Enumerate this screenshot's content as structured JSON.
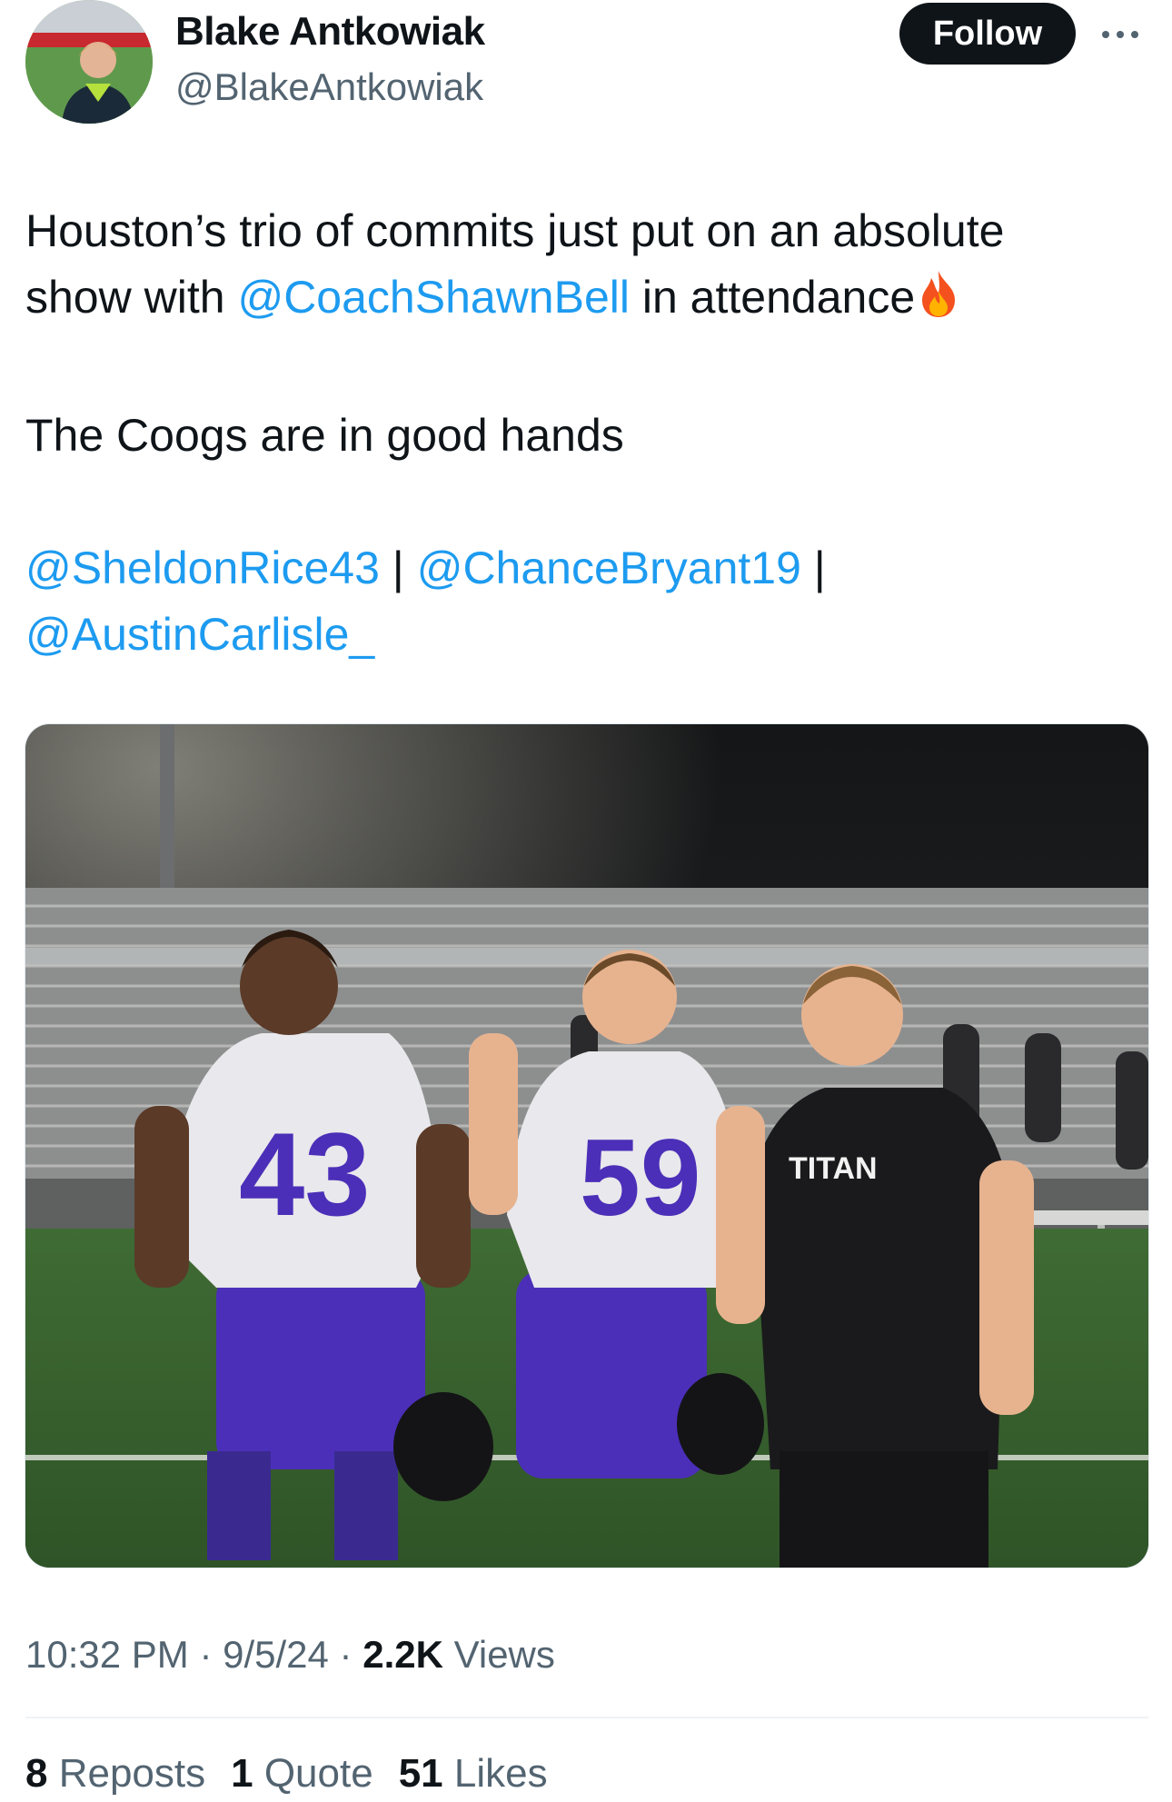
{
  "author": {
    "name": "Blake Antkowiak",
    "handle": "@BlakeAntkowiak"
  },
  "actions": {
    "follow_label": "Follow"
  },
  "tweet": {
    "line1": "Houston’s trio of commits just put on an absolute",
    "line2_prefix": "show with ",
    "mention_coach": "@CoachShawnBell",
    "line2_suffix": " in attendance",
    "line3": "The Coogs are in good hands",
    "mention_1": "@SheldonRice43",
    "separator": " | ",
    "mention_2": "@ChanceBryant19",
    "separator_2": " |",
    "mention_3": "@AustinCarlisle_"
  },
  "photo": {
    "jersey_numbers": [
      "43",
      "59"
    ],
    "shirt_text": "TITAN"
  },
  "meta": {
    "time": "10:32 PM",
    "dot": " · ",
    "date": "9/5/24",
    "views_count": "2.2K",
    "views_label": " Views"
  },
  "stats": {
    "reposts_count": "8",
    "reposts_label": " Reposts",
    "quotes_count": "1",
    "quotes_label": " Quote",
    "likes_count": "51",
    "likes_label": " Likes"
  },
  "icons": {
    "fire": "fire-emoji",
    "more": "more-dots-icon"
  }
}
